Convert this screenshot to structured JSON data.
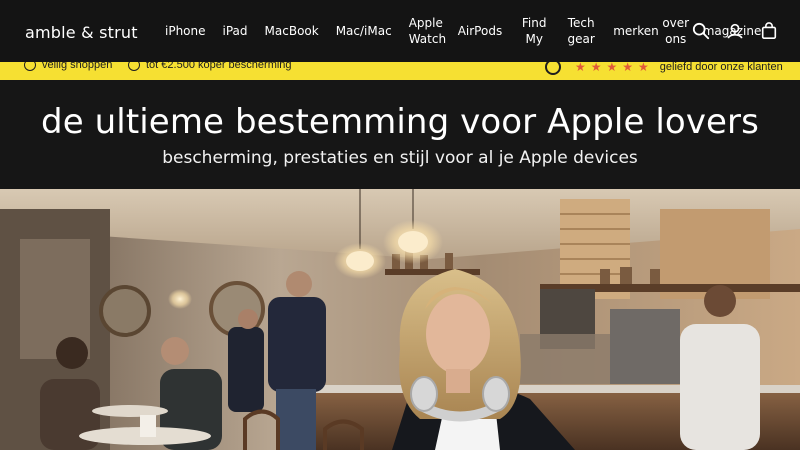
{
  "brand": {
    "logo": "amble & strut"
  },
  "nav": {
    "items": [
      "iPhone",
      "iPad",
      "MacBook",
      "Mac/iMac",
      "Apple Watch",
      "AirPods",
      "Find My",
      "Tech gear",
      "merken",
      "over ons",
      "magazine"
    ]
  },
  "header_icons": [
    "search-icon",
    "account-icon",
    "cart-icon"
  ],
  "trustbar": {
    "item1": "veilig shoppen",
    "item2": "tot €2.500 koper bescherming",
    "rating_text": "geliefd door onze klanten",
    "stars": "★★★★★"
  },
  "hero": {
    "title": "de ultieme bestemming voor Apple lovers",
    "subtitle": "bescherming, prestaties en stijl voor al je Apple devices"
  },
  "colors": {
    "header_bg": "#141414",
    "trustbar_bg": "#f6e032",
    "star": "#e05a3a"
  }
}
